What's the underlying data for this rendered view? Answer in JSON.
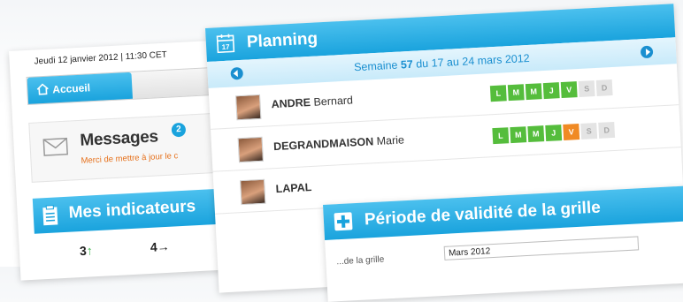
{
  "home": {
    "date": "Jeudi 12 janvier 2012  |  11:30 CET",
    "tabs": {
      "home_label": "Accueil"
    },
    "messages": {
      "title": "Messages",
      "count": "2",
      "subtitle": "Merci de mettre à jour le c"
    },
    "indicators": {
      "title": "Mes indicateurs",
      "values": [
        {
          "value": "3",
          "trend": "↑"
        },
        {
          "value": "4",
          "trend": "→"
        }
      ]
    }
  },
  "planning": {
    "title": "Planning",
    "week": {
      "label": "Semaine",
      "number": "57",
      "range": "du 17 au 24 mars 2012"
    },
    "rows": [
      {
        "last": "ANDRE",
        "first": "Bernard",
        "days": [
          {
            "d": "L",
            "s": "g"
          },
          {
            "d": "M",
            "s": "g"
          },
          {
            "d": "M",
            "s": "g"
          },
          {
            "d": "J",
            "s": "g"
          },
          {
            "d": "V",
            "s": "g"
          },
          {
            "d": "S",
            "s": "w"
          },
          {
            "d": "D",
            "s": "w"
          }
        ]
      },
      {
        "last": "DEGRANDMAISON",
        "first": "Marie",
        "days": [
          {
            "d": "L",
            "s": "g"
          },
          {
            "d": "M",
            "s": "g"
          },
          {
            "d": "M",
            "s": "g"
          },
          {
            "d": "J",
            "s": "g"
          },
          {
            "d": "V",
            "s": "o"
          },
          {
            "d": "S",
            "s": "w"
          },
          {
            "d": "D",
            "s": "w"
          }
        ]
      },
      {
        "last": "LAPAL",
        "first": "",
        "days": []
      }
    ],
    "colors": {
      "worked": "#55bd3c",
      "partial": "#f08a24",
      "off": "#e4e4e4"
    }
  },
  "validity": {
    "title": "Période de validité de la grille",
    "field_label": "...de la grille",
    "field_value": "Mars 2012"
  }
}
